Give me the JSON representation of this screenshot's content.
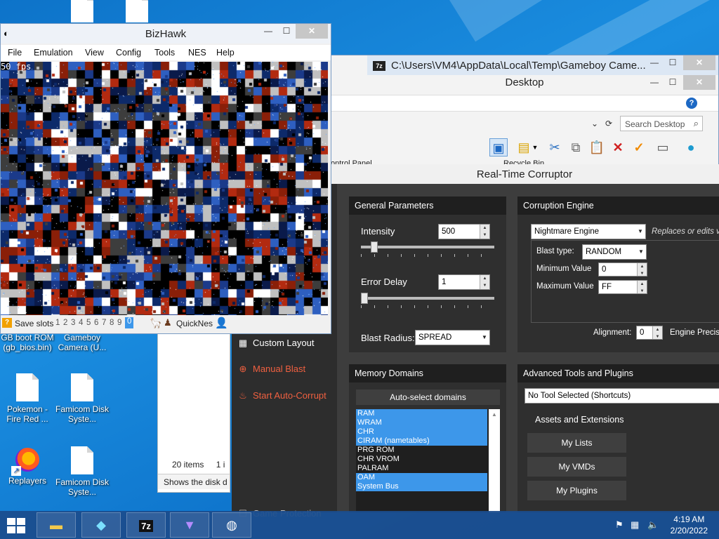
{
  "desktop": {
    "icons": [
      {
        "label": "GB boot ROM (gb_bios.bin)"
      },
      {
        "label": "Gameboy Camera (U..."
      },
      {
        "label": "Pokemon - Fire Red ..."
      },
      {
        "label": "Famicom Disk Syste..."
      },
      {
        "label": "Replayers"
      },
      {
        "label": "Famicom Disk Syste..."
      }
    ]
  },
  "explorer": {
    "title": "C:\\Users\\VM4\\AppData\\Local\\Temp\\Gameboy Came...",
    "app_badge": "7z",
    "folder_title": "Desktop",
    "search_placeholder": "Search Desktop",
    "columns": [
      "ontrol Panel",
      "Recycle Bin"
    ],
    "item_count": "20 items",
    "item_count_more": "1 i",
    "status_text": "Shows the disk d"
  },
  "rtc": {
    "title": "Real-Time Corruptor",
    "sidebar": {
      "custom_layout": "Custom Layout",
      "manual_blast": "Manual Blast",
      "auto_corrupt": "Start Auto-Corrupt",
      "game_protection": "Game Protection"
    },
    "general": {
      "header": "General Parameters",
      "intensity_label": "Intensity",
      "intensity_value": "500",
      "intensity_level": 0.08,
      "error_delay_label": "Error Delay",
      "error_delay_value": "1",
      "error_delay_level": 0.0,
      "blast_radius_label": "Blast Radius:",
      "blast_radius_value": "SPREAD"
    },
    "engine": {
      "header": "Corruption Engine",
      "engine_value": "Nightmare Engine",
      "engine_desc": "Replaces or edits val",
      "blast_type_label": "Blast type:",
      "blast_type_value": "RANDOM",
      "min_label": "Minimum Value",
      "min_value": "0",
      "max_label": "Maximum Value",
      "max_value": "FF",
      "alignment_label": "Alignment:",
      "alignment_value": "0",
      "precision_label": "Engine Precisi"
    },
    "memory": {
      "header": "Memory Domains",
      "auto_select": "Auto-select domains",
      "domains": [
        {
          "name": "RAM",
          "selected": true
        },
        {
          "name": "WRAM",
          "selected": true
        },
        {
          "name": "CHR",
          "selected": true
        },
        {
          "name": "CIRAM (nametables)",
          "selected": true
        },
        {
          "name": "PRG ROM",
          "selected": false
        },
        {
          "name": "CHR VROM",
          "selected": false
        },
        {
          "name": "PALRAM",
          "selected": false
        },
        {
          "name": "OAM",
          "selected": true
        },
        {
          "name": "System Bus",
          "selected": true
        }
      ]
    },
    "tools": {
      "header": "Advanced Tools and Plugins",
      "tool_select": "No Tool Selected (Shortcuts)",
      "assets_label": "Assets and Extensions",
      "my_lists": "My Lists",
      "my_vmds": "My VMDs",
      "my_plugins": "My Plugins"
    }
  },
  "bizhawk": {
    "title": "BizHawk",
    "menu": [
      "File",
      "Emulation",
      "View",
      "Config",
      "Tools",
      "NES",
      "Help"
    ],
    "fps": "50 fps",
    "save_slots_label": "Save slots",
    "slots": [
      "1",
      "2",
      "3",
      "4",
      "5",
      "6",
      "7",
      "8",
      "9",
      "0"
    ],
    "active_slot": "0",
    "core": "QuickNes"
  },
  "taskbar": {
    "time": "4:19 AM",
    "date": "2/20/2022"
  },
  "colors": {
    "rtc_dark": "#2f2f2f",
    "rtc_header": "#1f1f1f",
    "selection_blue": "#3d97ea",
    "accent_red": "#f06040"
  }
}
